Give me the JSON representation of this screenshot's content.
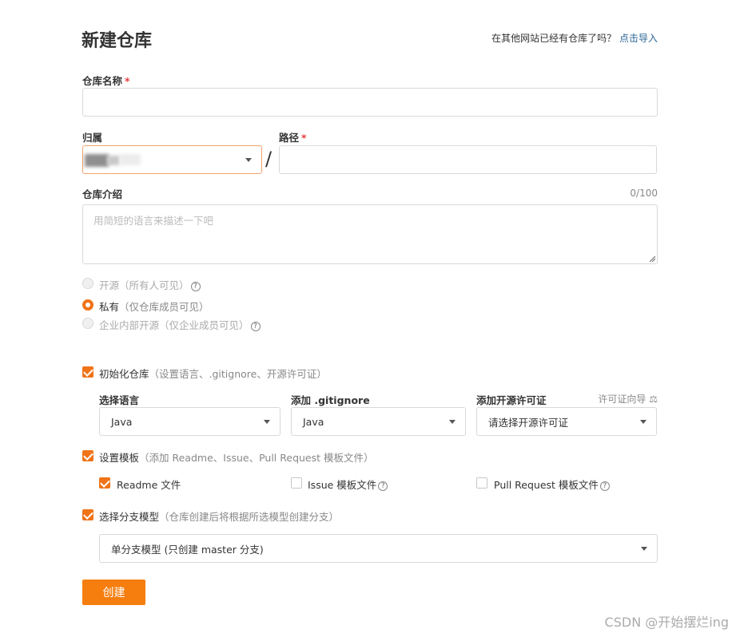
{
  "header": {
    "title": "新建仓库",
    "import_prompt": "在其他网站已经有仓库了吗？",
    "import_link": "点击导入"
  },
  "repo_name": {
    "label": "仓库名称",
    "required_mark": "*",
    "value": ""
  },
  "owner": {
    "label": "归属",
    "value": ""
  },
  "separator": "/",
  "path": {
    "label": "路径",
    "required_mark": "*",
    "value": ""
  },
  "description": {
    "label": "仓库介绍",
    "counter": "0/100",
    "placeholder": "用简短的语言来描述一下吧"
  },
  "visibility": {
    "options": [
      {
        "label": "开源",
        "hint": "（所有人可见）",
        "checked": false,
        "disabled": true
      },
      {
        "label": "私有",
        "hint": "（仅仓库成员可见）",
        "checked": true,
        "disabled": false
      },
      {
        "label": "企业内部开源",
        "hint": "（仅企业成员可见）",
        "checked": false,
        "disabled": true
      }
    ]
  },
  "init_repo": {
    "label": "初始化仓库",
    "hint": "（设置语言、.gitignore、开源许可证）",
    "checked": true,
    "language": {
      "label": "选择语言",
      "value": "Java"
    },
    "gitignore": {
      "label": "添加 .gitignore",
      "value": "Java"
    },
    "license": {
      "label": "添加开源许可证",
      "value": "请选择开源许可证",
      "guide": "许可证向导",
      "guide_icon": "⚖"
    }
  },
  "template": {
    "label": "设置模板",
    "hint": "（添加 Readme、Issue、Pull Request 模板文件）",
    "checked": true,
    "readme": {
      "label": "Readme 文件",
      "checked": true
    },
    "issue": {
      "label": "Issue 模板文件",
      "checked": false
    },
    "pull_request": {
      "label": "Pull Request 模板文件",
      "checked": false
    }
  },
  "branch_model": {
    "label": "选择分支模型",
    "hint": "（仓库创建后将根据所选模型创建分支）",
    "checked": true,
    "value": "单分支模型 (只创建 master 分支)"
  },
  "create_button": "创建",
  "watermark": "CSDN @开始摆烂ing",
  "colors": {
    "accent": "#f57e0f",
    "link": "#2a6496",
    "required": "#e63e3e"
  }
}
